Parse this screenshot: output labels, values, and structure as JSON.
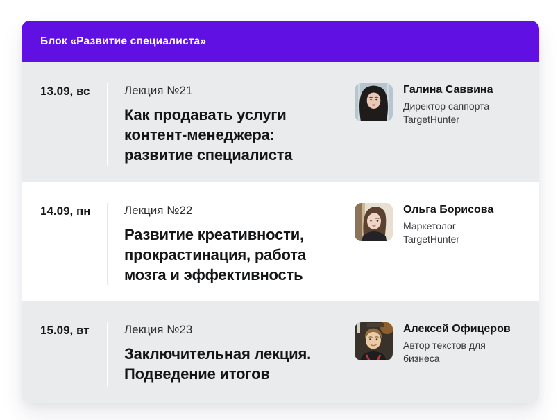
{
  "colors": {
    "header_bg": "#6110E3",
    "row_alt_bg": "#EAEBED"
  },
  "header": {
    "title": "Блок «Развитие специалиста»"
  },
  "rows": [
    {
      "date": "13.09, вс",
      "lecture_label": "Лекция №21",
      "title": "Как продавать услуги\nконтент-менеджера:\nразвитие специалиста",
      "speaker": {
        "name": "Галина Саввина",
        "role": "Директор саппорта\nTargetHunter",
        "avatar": "woman-long-dark-hair-photo"
      }
    },
    {
      "date": "14.09, пн",
      "lecture_label": "Лекция №22",
      "title": "Развитие креативности,\nпрокрастинация, работа\nмозга и эффективность",
      "speaker": {
        "name": "Ольга Борисова",
        "role": "Маркетолог\nTargetHunter",
        "avatar": "woman-auburn-hair-photo"
      }
    },
    {
      "date": "15.09, вт",
      "lecture_label": "Лекция №23",
      "title": "Заключительная лекция.\nПодведение итогов",
      "speaker": {
        "name": "Алексей Офицеров",
        "role": "Автор текстов для\nбизнеса",
        "avatar": "man-short-hair-photo"
      }
    }
  ]
}
